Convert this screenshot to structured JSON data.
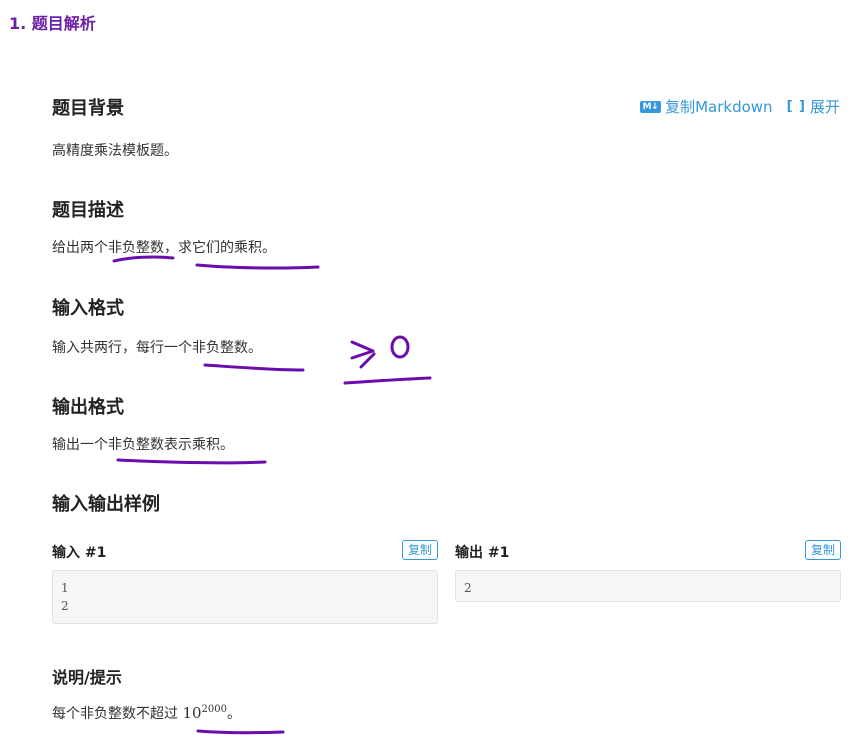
{
  "page_heading": "1. 题目解析",
  "actions": {
    "md_icon": "M↓",
    "copy_markdown": "复制Markdown",
    "expand_icon": "[ ]",
    "expand": "展开"
  },
  "sections": {
    "background_title": "题目背景",
    "background_text": "高精度乘法模板题。",
    "description_title": "题目描述",
    "description_text": "给出两个非负整数，求它们的乘积。",
    "input_title": "输入格式",
    "input_text": "输入共两行，每行一个非负整数。",
    "output_title": "输出格式",
    "output_text": "输出一个非负整数表示乘积。",
    "samples_title": "输入输出样例",
    "hint_title": "说明/提示",
    "hint_text": "每个非负整数不超过",
    "hint_math_base": "10",
    "hint_math_exp": "2000",
    "hint_tail": "。"
  },
  "samples": {
    "input_label": "输入 #1",
    "output_label": "输出 #1",
    "copy_label": "复制",
    "input_value": "1\n2",
    "output_value": "2"
  },
  "annotations": {
    "ink_color": "#6a0dad",
    "handwritten_note": ">,0"
  }
}
